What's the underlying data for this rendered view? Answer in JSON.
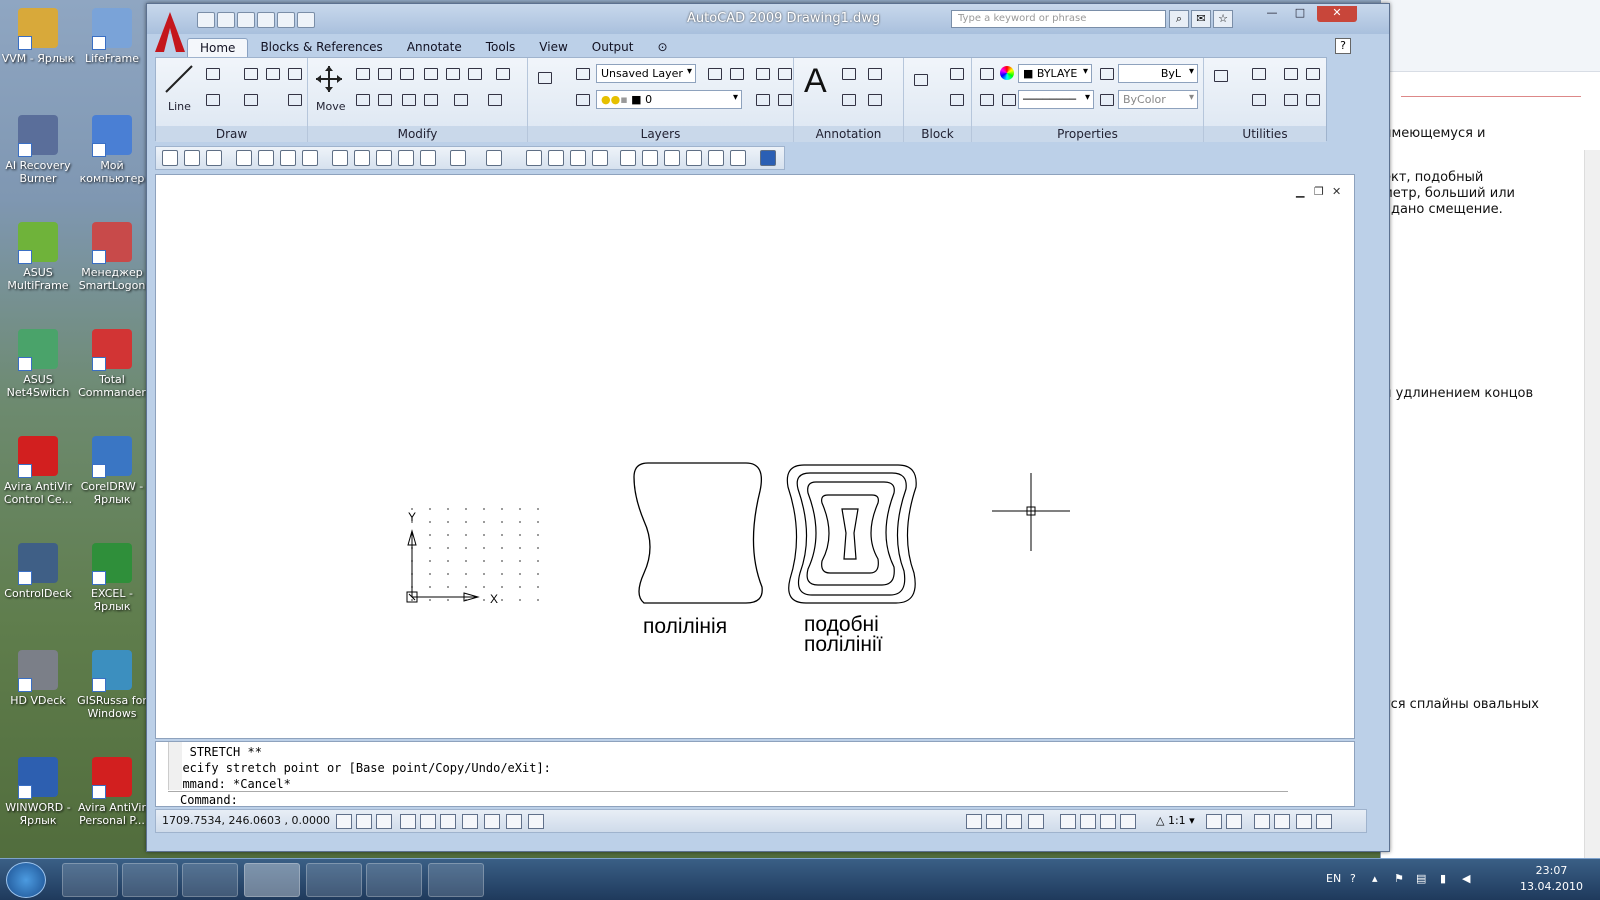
{
  "desktop": {
    "icons": [
      {
        "label": "VVM - Ярлык",
        "color": "#d8a93a",
        "icon": "folder-icon"
      },
      {
        "label": "LifeFrame",
        "color": "#7aa3d8",
        "icon": "webcam-icon"
      },
      {
        "label": "AI Recovery Burner",
        "color": "#5a6e9a",
        "icon": "disc-icon"
      },
      {
        "label": "Мой компьютер",
        "color": "#4a7fd4",
        "icon": "computer-icon"
      },
      {
        "label": "ASUS MultiFrame",
        "color": "#6fb33a",
        "icon": "windows-icon"
      },
      {
        "label": "Менеджер SmartLogon",
        "color": "#c84a4a",
        "icon": "shield-icon"
      },
      {
        "label": "ASUS Net4Switch",
        "color": "#4aa36a",
        "icon": "network-icon"
      },
      {
        "label": "Total Commander",
        "color": "#d23434",
        "icon": "floppy-icon"
      },
      {
        "label": "Avira AntiVir Control Ce...",
        "color": "#d21f1f",
        "icon": "umbrella-icon"
      },
      {
        "label": "CorelDRW - Ярлык",
        "color": "#3a76c4",
        "icon": "balloon-icon"
      },
      {
        "label": "ControlDeck",
        "color": "#3f5f86",
        "icon": "dial-icon"
      },
      {
        "label": "EXCEL - Ярлык",
        "color": "#2f8f3a",
        "icon": "excel-icon"
      },
      {
        "label": "HD VDeck",
        "color": "#7b7f88",
        "icon": "speaker-icon"
      },
      {
        "label": "GISRussa for Windows",
        "color": "#3c8fbf",
        "icon": "globe-icon"
      },
      {
        "label": "WINWORD - Ярлык",
        "color": "#2d5fb0",
        "icon": "word-icon"
      },
      {
        "label": "Avira AntiVir Personal P...",
        "color": "#d21f1f",
        "icon": "umbrella-icon"
      }
    ]
  },
  "bg_document": {
    "lines": [
      "имеющемуся и",
      "ект, подобный",
      "метр, больший или",
      "адано смещение.",
      "и удлинением концов",
      "тся сплайны овальных"
    ]
  },
  "window": {
    "title": "AutoCAD 2009  Drawing1.dwg",
    "search_placeholder": "Type a keyword or phrase",
    "tabs": [
      "Home",
      "Blocks & References",
      "Annotate",
      "Tools",
      "View",
      "Output"
    ],
    "panels": {
      "draw": {
        "title": "Draw",
        "line_label": "Line"
      },
      "modify": {
        "title": "Modify",
        "move_label": "Move"
      },
      "layers": {
        "title": "Layers",
        "layer_dropdown": "Unsaved Layer",
        "layer_current": "0"
      },
      "annotation": {
        "title": "Annotation",
        "big_text": "A"
      },
      "block": {
        "title": "Block"
      },
      "properties": {
        "title": "Properties",
        "color": "BYLAYE",
        "lineweight": "ByL",
        "plotstyle": "ByColor"
      },
      "utilities": {
        "title": "Utilities"
      }
    }
  },
  "drawing": {
    "label_polyline": "полілінія",
    "label_similar_1": "подобні",
    "label_similar_2": "полілінії",
    "ucs_y": "Y",
    "ucs_x": "X"
  },
  "command": {
    "lines": [
      "** STRETCH **",
      "Specify stretch point or [Base point/Copy/Undo/eXit]:",
      "Command: *Cancel*"
    ],
    "prompt": "Command:"
  },
  "status": {
    "coords": "1709.7534, 246.0603 , 0.0000",
    "scale": "1:1"
  },
  "taskbar": {
    "lang": "EN",
    "time": "23:07",
    "date": "13.04.2010"
  }
}
